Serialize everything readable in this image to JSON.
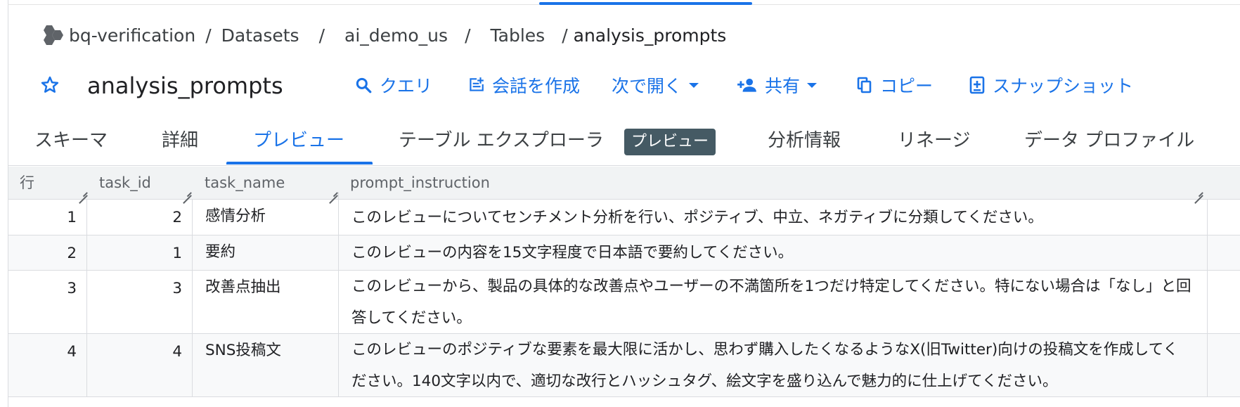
{
  "breadcrumb": {
    "project": "bq-verification",
    "datasets": "Datasets",
    "dataset": "ai_demo_us",
    "tables": "Tables",
    "table": "analysis_prompts",
    "separator": "/"
  },
  "header": {
    "title": "analysis_prompts",
    "actions": {
      "query": "クエリ",
      "conversation": "会話を作成",
      "open_with": "次で開く",
      "share": "共有",
      "copy": "コピー",
      "snapshot": "スナップショット"
    }
  },
  "tabs": [
    {
      "label": "スキーマ"
    },
    {
      "label": "詳細"
    },
    {
      "label": "プレビュー"
    },
    {
      "label": "テーブル エクスプローラ"
    },
    {
      "label": "分析情報"
    },
    {
      "label": "リネージ"
    },
    {
      "label": "データ プロファイル"
    }
  ],
  "badge": "プレビュー",
  "table": {
    "columns": [
      "行",
      "task_id",
      "task_name",
      "prompt_instruction"
    ],
    "rows": [
      {
        "row": "1",
        "task_id": "2",
        "task_name": "感情分析",
        "prompt": "このレビューについてセンチメント分析を行い、ポジティブ、中立、ネガティブに分類してください。"
      },
      {
        "row": "2",
        "task_id": "1",
        "task_name": "要約",
        "prompt": "このレビューの内容を15文字程度で日本語で要約してください。"
      },
      {
        "row": "3",
        "task_id": "3",
        "task_name": "改善点抽出",
        "prompt": "このレビューから、製品の具体的な改善点やユーザーの不満箇所を1つだけ特定してください。特にない場合は「なし」と回答してください。"
      },
      {
        "row": "4",
        "task_id": "4",
        "task_name": "SNS投稿文",
        "prompt": "このレビューのポジティブな要素を最大限に活かし、思わず購入したくなるようなX(旧Twitter)向けの投稿文を作成してください。140文字以内で、適切な改行とハッシュタグ、絵文字を盛り込んで魅力的に仕上げてください。"
      }
    ]
  },
  "colors": {
    "accent": "#1a73e8",
    "badge_bg": "#455a64",
    "header_bg": "#f1f3f4",
    "border": "#dadce0"
  },
  "icons": {
    "logo": "bigquery-hexagons-icon",
    "star": "star-outline-icon",
    "query": "search-icon",
    "conversation": "compose-chat-icon",
    "share": "person-add-icon",
    "copy": "copy-icon",
    "snapshot": "snapshot-add-icon"
  }
}
